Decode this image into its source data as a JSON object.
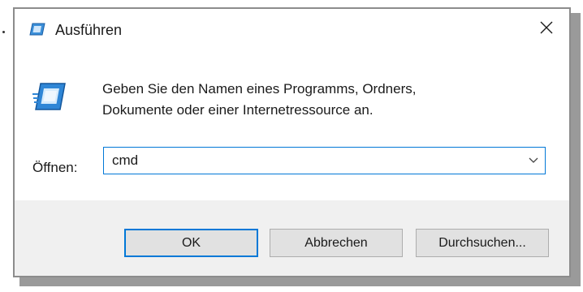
{
  "window": {
    "title": "Ausführen",
    "close_icon": "close-icon",
    "app_icon": "run-icon"
  },
  "body": {
    "description_line1": "Geben Sie den Namen eines Programms, Ordners,",
    "description_line2": "Dokumente oder einer Internetressource an.",
    "open_label": "Öffnen:",
    "input_value": "cmd",
    "dropdown_icon": "chevron-down-icon"
  },
  "buttons": {
    "ok": "OK",
    "cancel": "Abbrechen",
    "browse": "Durchsuchen..."
  },
  "colors": {
    "accent": "#0078d7",
    "footer_bg": "#f0f0f0",
    "button_bg": "#e1e1e1"
  }
}
